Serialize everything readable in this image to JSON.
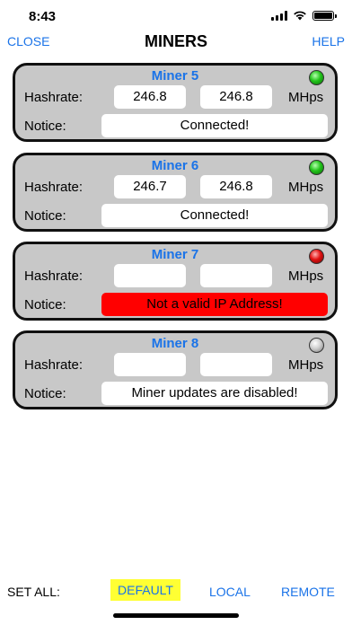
{
  "status_bar": {
    "time": "8:43"
  },
  "nav": {
    "close_label": "CLOSE",
    "title": "MINERS",
    "help_label": "HELP"
  },
  "miners": [
    {
      "name": "Miner 5",
      "led": "green",
      "hash_label": "Hashrate:",
      "hash1": "246.8",
      "hash2": "246.8",
      "unit": "MHps",
      "notice_label": "Notice:",
      "notice": "Connected!"
    },
    {
      "name": "Miner 6",
      "led": "green",
      "hash_label": "Hashrate:",
      "hash1": "246.7",
      "hash2": "246.8",
      "unit": "MHps",
      "notice_label": "Notice:",
      "notice": "Connected!"
    },
    {
      "name": "Miner 7",
      "led": "red",
      "hash_label": "Hashrate:",
      "hash1": "",
      "hash2": "",
      "unit": "MHps",
      "notice_label": "Notice:",
      "notice": "Not a valid IP Address!"
    },
    {
      "name": "Miner 8",
      "led": "gray",
      "hash_label": "Hashrate:",
      "hash1": "",
      "hash2": "",
      "unit": "MHps",
      "notice_label": "Notice:",
      "notice": "Miner updates are disabled!"
    }
  ],
  "bottom": {
    "set_all_label": "SET ALL:",
    "default_label": "DEFAULT",
    "local_label": "LOCAL",
    "remote_label": "REMOTE"
  },
  "colors": {
    "accent": "#1a73e8",
    "card_bg": "#c8c8c8",
    "error": "#ff0000",
    "selected": "#ffff33"
  }
}
